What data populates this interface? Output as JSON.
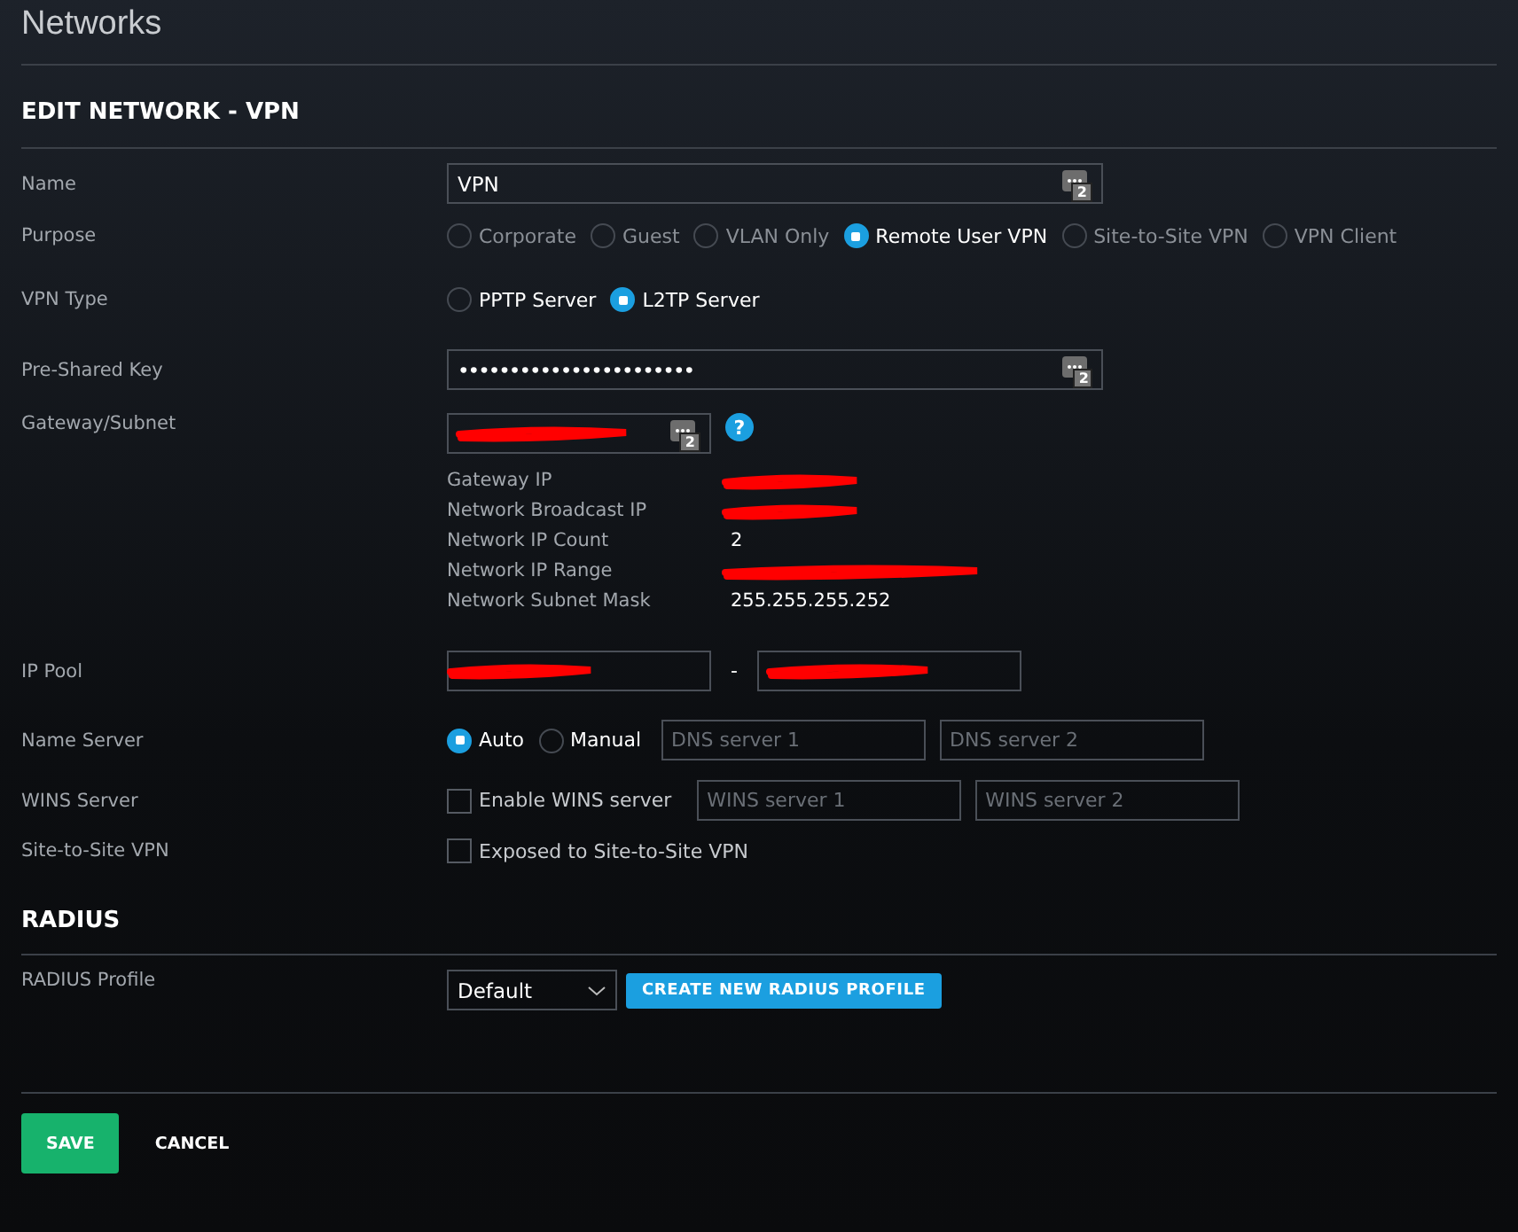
{
  "page": {
    "title": "Networks"
  },
  "form": {
    "title": "EDIT NETWORK - VPN",
    "name": {
      "label": "Name",
      "value": "VPN",
      "badge": "2"
    },
    "purpose": {
      "label": "Purpose",
      "options": [
        {
          "label": "Corporate",
          "selected": false,
          "disabled": true
        },
        {
          "label": "Guest",
          "selected": false,
          "disabled": true
        },
        {
          "label": "VLAN Only",
          "selected": false,
          "disabled": true
        },
        {
          "label": "Remote User VPN",
          "selected": true,
          "disabled": false
        },
        {
          "label": "Site-to-Site VPN",
          "selected": false,
          "disabled": true
        },
        {
          "label": "VPN Client",
          "selected": false,
          "disabled": true
        }
      ]
    },
    "vpn_type": {
      "label": "VPN Type",
      "options": [
        {
          "label": "PPTP Server",
          "selected": false,
          "disabled": false
        },
        {
          "label": "L2TP Server",
          "selected": true,
          "disabled": false
        }
      ]
    },
    "pre_shared_key": {
      "label": "Pre-Shared Key",
      "value": "•••••••••••••••••••••••",
      "badge": "2"
    },
    "gateway_subnet": {
      "label": "Gateway/Subnet",
      "redacted": true,
      "badge": "2",
      "help": "?"
    },
    "details": [
      {
        "label": "Gateway IP",
        "redacted": true
      },
      {
        "label": "Network Broadcast IP",
        "redacted": true
      },
      {
        "label": "Network IP Count",
        "value": "2"
      },
      {
        "label": "Network IP Range",
        "redacted": true
      },
      {
        "label": "Network Subnet Mask",
        "value": "255.255.255.252"
      }
    ],
    "ip_pool": {
      "label": "IP Pool",
      "start_redacted": true,
      "separator": "-",
      "end_redacted": true
    },
    "name_server": {
      "label": "Name Server",
      "options": [
        {
          "label": "Auto",
          "selected": true,
          "disabled": false
        },
        {
          "label": "Manual",
          "selected": false,
          "disabled": false
        }
      ],
      "fields": [
        {
          "placeholder": "DNS server 1"
        },
        {
          "placeholder": "DNS server 2"
        }
      ]
    },
    "wins_server": {
      "label": "WINS Server",
      "checkbox": {
        "label": "Enable WINS server",
        "checked": false
      },
      "fields": [
        {
          "placeholder": "WINS server 1"
        },
        {
          "placeholder": "WINS server 2"
        }
      ]
    },
    "site_to_site": {
      "label": "Site-to-Site VPN",
      "checkbox": {
        "label": "Exposed to Site-to-Site VPN",
        "checked": false
      }
    }
  },
  "radius": {
    "title": "RADIUS",
    "profile": {
      "label": "RADIUS Profile",
      "value": "Default",
      "button": "CREATE NEW RADIUS PROFILE"
    }
  },
  "buttons": [
    {
      "label": "SAVE",
      "kind": "primary"
    },
    {
      "label": "CANCEL",
      "kind": "plain"
    }
  ]
}
